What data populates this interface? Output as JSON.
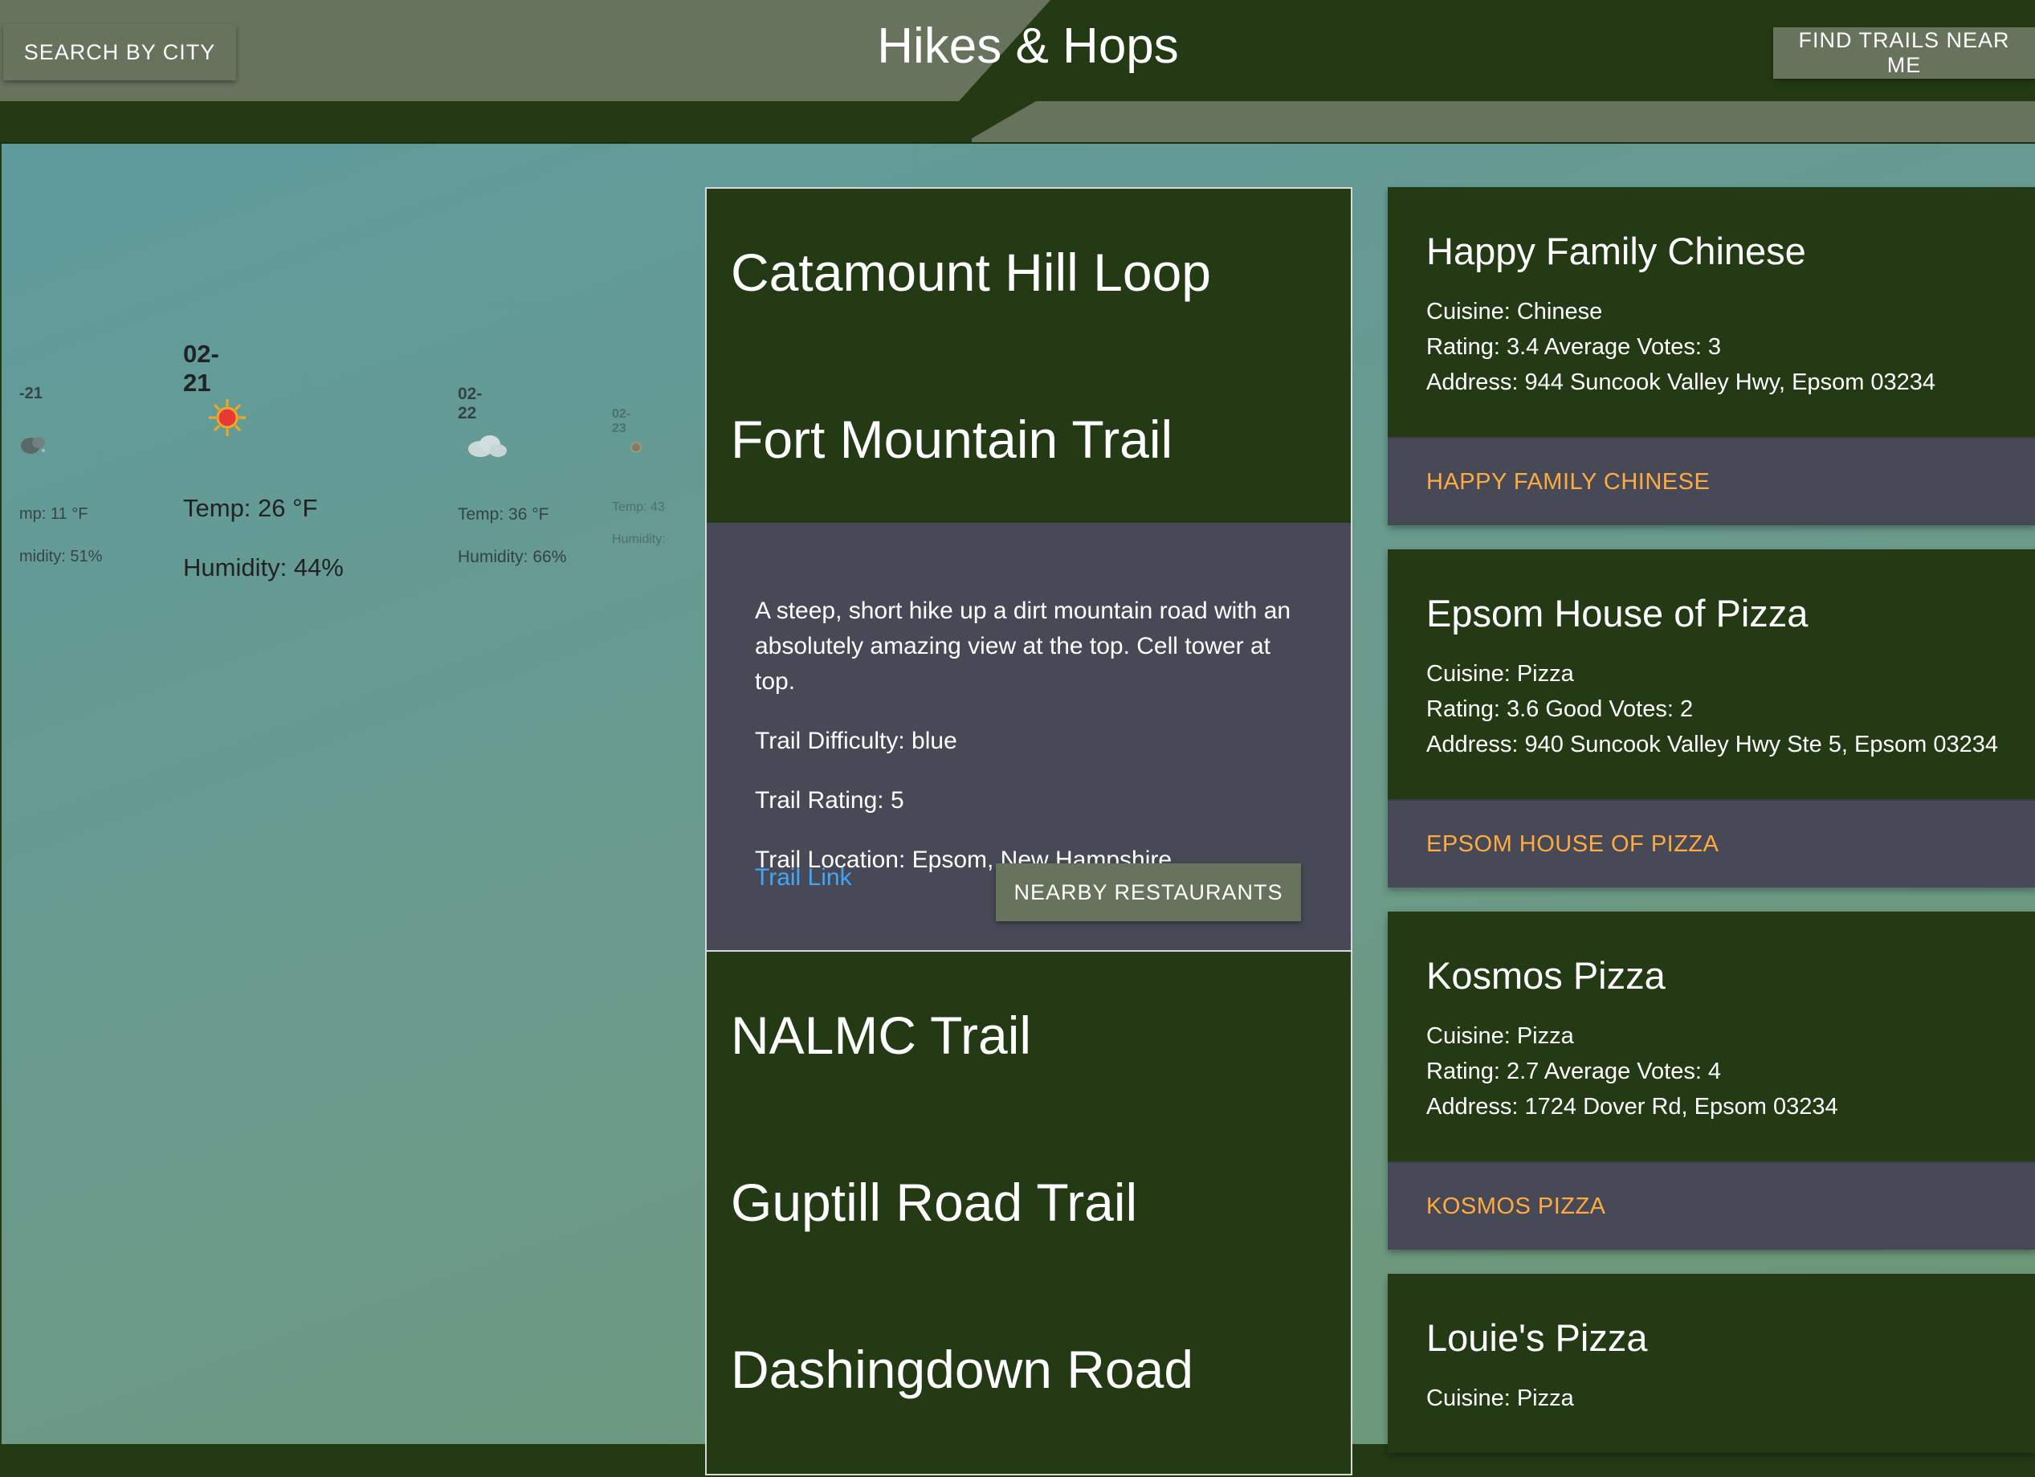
{
  "header": {
    "title": "Hikes & Hops",
    "search_label": "SEARCH BY CITY",
    "near_label": "FIND TRAILS NEAR ME"
  },
  "weather": [
    {
      "date": "-21",
      "icon": "cloud-rain-icon",
      "temp": "mp: 11 °F",
      "humidity": "midity: 51%"
    },
    {
      "date": "02-21",
      "icon": "sun-icon",
      "temp": "Temp: 26 °F",
      "humidity": "Humidity: 44%"
    },
    {
      "date": "02-22",
      "icon": "cloud-icon",
      "temp": "Temp: 36 °F",
      "humidity": "Humidity: 66%"
    },
    {
      "date": "02-23",
      "icon": "sun-icon",
      "temp": "Temp: 43",
      "humidity": "Humidity:"
    }
  ],
  "trails": {
    "items": [
      {
        "name": "Catamount Hill Loop"
      },
      {
        "name": "Fort Mountain Trail"
      },
      {
        "name": "NALMC Trail"
      },
      {
        "name": "Guptill Road Trail"
      },
      {
        "name": "Dashingdown Road"
      }
    ],
    "expanded": {
      "description": "A steep, short hike up a dirt mountain road with an absolutely amazing view at the top. Cell tower at top.",
      "difficulty": "Trail Difficulty: blue",
      "rating": "Trail Rating: 5",
      "location": "Trail Location: Epsom, New Hampshire",
      "link_label": "Trail Link",
      "button_label": "NEARBY RESTAURANTS"
    }
  },
  "restaurants": [
    {
      "name": "Happy Family Chinese",
      "cuisine": "Cuisine: Chinese",
      "rating": "Rating: 3.4 Average Votes: 3",
      "address": "Address: 944 Suncook Valley Hwy, Epsom 03234",
      "link": "HAPPY FAMILY CHINESE"
    },
    {
      "name": "Epsom House of Pizza",
      "cuisine": "Cuisine: Pizza",
      "rating": "Rating: 3.6 Good Votes: 2",
      "address": "Address: 940 Suncook Valley Hwy Ste 5, Epsom 03234",
      "link": "EPSOM HOUSE OF PIZZA"
    },
    {
      "name": "Kosmos Pizza",
      "cuisine": "Cuisine: Pizza",
      "rating": "Rating: 2.7 Average Votes: 4",
      "address": "Address: 1724 Dover Rd, Epsom 03234",
      "link": "KOSMOS PIZZA"
    },
    {
      "name": "Louie's Pizza",
      "cuisine": "Cuisine: Pizza"
    }
  ],
  "colors": {
    "dark_green": "#233a14",
    "sage": "#68735e",
    "slate": "#474957",
    "link_blue": "#42a5f5",
    "accent_orange": "#ffab40"
  }
}
